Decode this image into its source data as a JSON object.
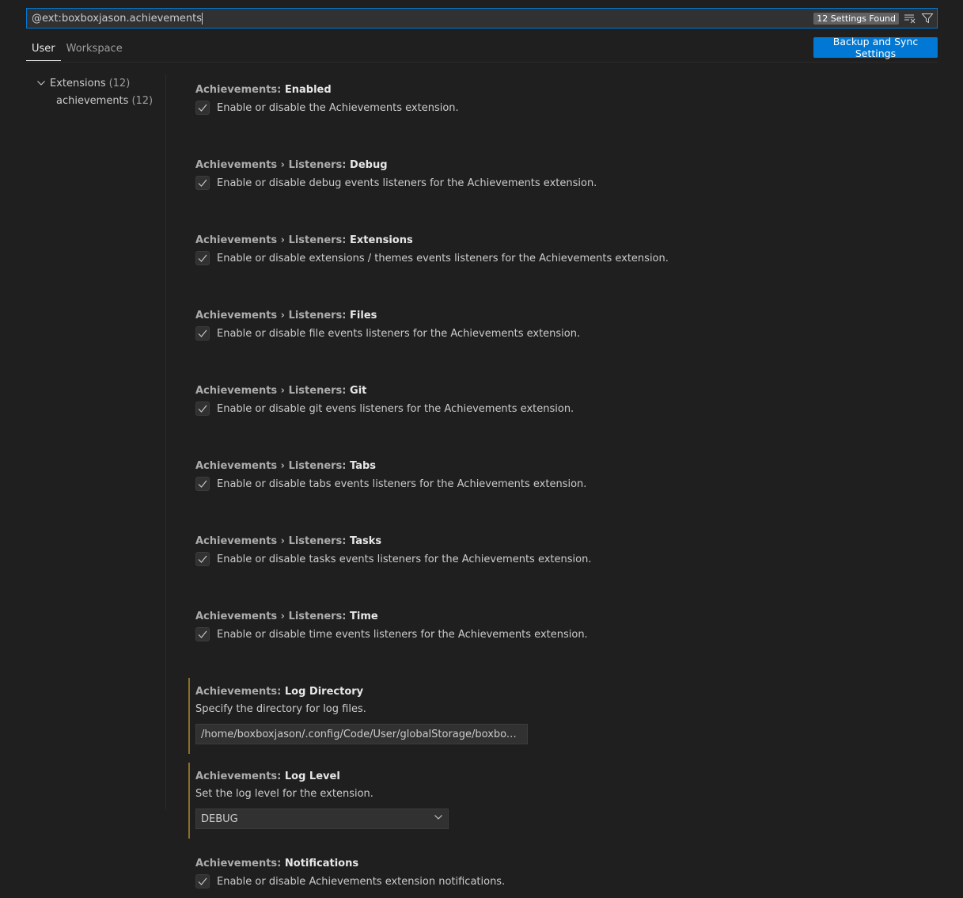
{
  "search": {
    "value": "@ext:boxboxjason.achievements",
    "count_badge": "12 Settings Found",
    "clear_icon": "clear-filter-icon",
    "filter_icon": "filter-icon"
  },
  "tabs": [
    {
      "label": "User",
      "active": true
    },
    {
      "label": "Workspace",
      "active": false
    }
  ],
  "sync_button": "Backup and Sync Settings",
  "toc": {
    "group_label": "Extensions",
    "group_count": "(12)",
    "sub_label": "achievements",
    "sub_count": "(12)"
  },
  "settings": [
    {
      "category": "Achievements: ",
      "name": "Enabled",
      "description": "Enable or disable the Achievements extension.",
      "type": "boolean",
      "checked": true
    },
    {
      "category": "Achievements › Listeners: ",
      "name": "Debug",
      "description": "Enable or disable debug events listeners for the Achievements extension.",
      "type": "boolean",
      "checked": true
    },
    {
      "category": "Achievements › Listeners: ",
      "name": "Extensions",
      "description": "Enable or disable extensions / themes events listeners for the Achievements extension.",
      "type": "boolean",
      "checked": true
    },
    {
      "category": "Achievements › Listeners: ",
      "name": "Files",
      "description": "Enable or disable file events listeners for the Achievements extension.",
      "type": "boolean",
      "checked": true
    },
    {
      "category": "Achievements › Listeners: ",
      "name": "Git",
      "description": "Enable or disable git evens listeners for the Achievements extension.",
      "type": "boolean",
      "checked": true
    },
    {
      "category": "Achievements › Listeners: ",
      "name": "Tabs",
      "description": "Enable or disable tabs events listeners for the Achievements extension.",
      "type": "boolean",
      "checked": true
    },
    {
      "category": "Achievements › Listeners: ",
      "name": "Tasks",
      "description": "Enable or disable tasks events listeners for the Achievements extension.",
      "type": "boolean",
      "checked": true
    },
    {
      "category": "Achievements › Listeners: ",
      "name": "Time",
      "description": "Enable or disable time events listeners for the Achievements extension.",
      "type": "boolean",
      "checked": true
    },
    {
      "category": "Achievements: ",
      "name": "Log Directory",
      "description": "Specify the directory for log files.",
      "type": "string",
      "value": "/home/boxboxjason/.config/Code/User/globalStorage/boxboxjason.achievements/logs",
      "modified": true
    },
    {
      "category": "Achievements: ",
      "name": "Log Level",
      "description": "Set the log level for the extension.",
      "type": "enum",
      "value": "DEBUG",
      "modified": true
    },
    {
      "category": "Achievements: ",
      "name": "Notifications",
      "description": "Enable or disable Achievements extension notifications.",
      "type": "boolean",
      "checked": true
    }
  ],
  "colors": {
    "accent": "#0078d4",
    "modified_indicator": "#8a6e25",
    "background": "#1f1f1f"
  }
}
